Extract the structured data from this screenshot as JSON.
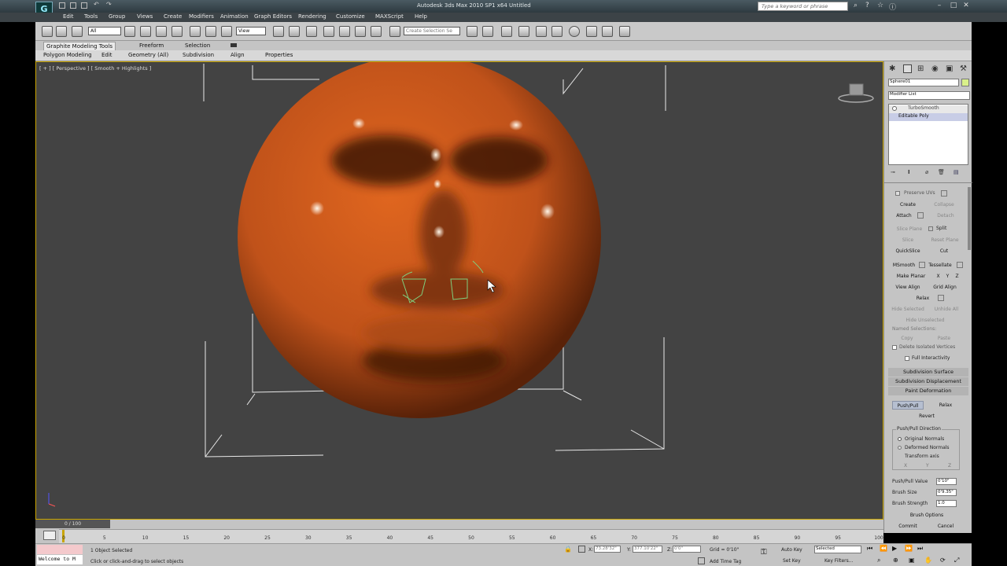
{
  "title": "Autodesk 3ds Max 2010 SP1 x64    Untitled",
  "app_logo": "G",
  "search_placeholder": "Type a keyword or phrase",
  "menu": [
    "Edit",
    "Tools",
    "Group",
    "Views",
    "Create",
    "Modifiers",
    "Animation",
    "Graph Editors",
    "Rendering",
    "Customize",
    "MAXScript",
    "Help"
  ],
  "toolbar": {
    "selection_filter": "All",
    "ref_coord": "View",
    "named_selection": "Create Selection Se"
  },
  "ribbon": {
    "tabs": [
      "Graphite Modeling Tools",
      "Freeform",
      "Selection"
    ],
    "subtabs": [
      "Polygon Modeling",
      "Edit",
      "Geometry (All)",
      "Subdivision",
      "Align",
      "Properties"
    ]
  },
  "viewport": {
    "label": "[ + ] [ Perspective ] [ Smooth + Highlights ]",
    "object_color": "#d2571a"
  },
  "command_panel": {
    "object_name": "Sphere01",
    "modifier_list": "Modifier List",
    "stack": [
      "TurboSmooth",
      "Editable Poly"
    ],
    "edit_geometry": {
      "preserve_uvs": "Preserve UVs",
      "create": "Create",
      "collapse": "Collapse",
      "attach": "Attach",
      "detach": "Detach",
      "slice_plane": "Slice Plane",
      "split": "Split",
      "slice": "Slice",
      "reset_plane": "Reset Plane",
      "quickslice": "QuickSlice",
      "cut": "Cut",
      "msmooth": "MSmooth",
      "tessellate": "Tessellate",
      "make_planar": "Make Planar",
      "x": "X",
      "y": "Y",
      "z": "Z",
      "view_align": "View Align",
      "grid_align": "Grid Align",
      "relax": "Relax",
      "hide_selected": "Hide Selected",
      "unhide_all": "Unhide All",
      "hide_unselected": "Hide Unselected",
      "named_selections": "Named Selections:",
      "copy": "Copy",
      "paste": "Paste",
      "delete_isolated": "Delete Isolated Vertices",
      "full_interactivity": "Full Interactivity"
    },
    "rollouts": [
      "Subdivision Surface",
      "Subdivision Displacement",
      "Paint Deformation"
    ],
    "paint_deformation": {
      "push_pull": "Push/Pull",
      "relax": "Relax",
      "revert": "Revert",
      "direction_label": "Push/Pull Direction",
      "original_normals": "Original Normals",
      "deformed_normals": "Deformed Normals",
      "transform_axis": "Transform axis",
      "axis_x": "X",
      "axis_y": "Y",
      "axis_z": "Z",
      "push_pull_value_label": "Push/Pull Value",
      "push_pull_value": "0'10\"",
      "brush_size_label": "Brush Size",
      "brush_size": "0'9.35\"",
      "brush_strength_label": "Brush Strength",
      "brush_strength": "1.0",
      "brush_options": "Brush Options",
      "commit": "Commit",
      "cancel": "Cancel"
    }
  },
  "timeline": {
    "frame": "0 / 100",
    "ticks": [
      "0",
      "5",
      "10",
      "15",
      "20",
      "25",
      "30",
      "35",
      "40",
      "45",
      "50",
      "55",
      "60",
      "65",
      "70",
      "75",
      "80",
      "85",
      "90",
      "95",
      "100"
    ]
  },
  "status": {
    "maxscript": "Welcome to M",
    "selected": "1 Object Selected",
    "prompt": "Click or click-and-drag to select objects",
    "x_label": "X:",
    "x": "73.28'32\"",
    "y_label": "Y:",
    "y": "377.10'22\"",
    "z_label": "Z:",
    "z": "0'0\"",
    "grid": "Grid = 0'10\"",
    "add_time_tag": "Add Time Tag",
    "auto_key": "Auto Key",
    "set_key": "Set Key",
    "key_mode": "Selected",
    "key_filters": "Key Filters..."
  }
}
